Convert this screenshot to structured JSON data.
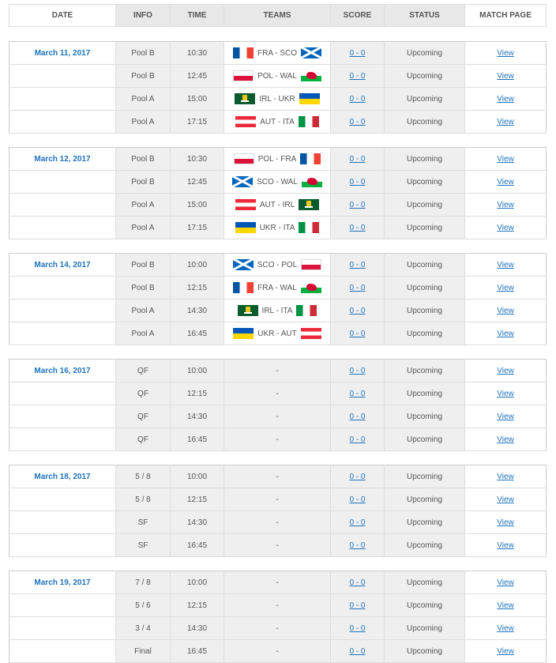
{
  "headers": {
    "date": "DATE",
    "info": "INFO",
    "time": "TIME",
    "teams": "TEAMS",
    "score": "SCORE",
    "status": "STATUS",
    "page": "MATCH PAGE"
  },
  "groups": [
    {
      "date": "March 11, 2017",
      "matches": [
        {
          "info": "Pool B",
          "time": "10:30",
          "home": "fra",
          "away": "sco",
          "teams": "FRA - SCO",
          "score": "0 - 0",
          "status": "Upcoming",
          "link": "View"
        },
        {
          "info": "Pool B",
          "time": "12:45",
          "home": "pol",
          "away": "wal",
          "teams": "POL - WAL",
          "score": "0 - 0",
          "status": "Upcoming",
          "link": "View"
        },
        {
          "info": "Pool A",
          "time": "15:00",
          "home": "irl",
          "away": "ukr",
          "teams": "IRL - UKR",
          "score": "0 - 0",
          "status": "Upcoming",
          "link": "View"
        },
        {
          "info": "Pool A",
          "time": "17:15",
          "home": "aut",
          "away": "ita",
          "teams": "AUT - ITA",
          "score": "0 - 0",
          "status": "Upcoming",
          "link": "View"
        }
      ]
    },
    {
      "date": "March 12, 2017",
      "matches": [
        {
          "info": "Pool B",
          "time": "10:30",
          "home": "pol",
          "away": "fra",
          "teams": "POL - FRA",
          "score": "0 - 0",
          "status": "Upcoming",
          "link": "View"
        },
        {
          "info": "Pool B",
          "time": "12:45",
          "home": "sco",
          "away": "wal",
          "teams": "SCO - WAL",
          "score": "0 - 0",
          "status": "Upcoming",
          "link": "View"
        },
        {
          "info": "Pool A",
          "time": "15:00",
          "home": "aut",
          "away": "irl",
          "teams": "AUT - IRL",
          "score": "0 - 0",
          "status": "Upcoming",
          "link": "View"
        },
        {
          "info": "Pool A",
          "time": "17:15",
          "home": "ukr",
          "away": "ita",
          "teams": "UKR - ITA",
          "score": "0 - 0",
          "status": "Upcoming",
          "link": "View"
        }
      ]
    },
    {
      "date": "March 14, 2017",
      "matches": [
        {
          "info": "Pool B",
          "time": "10:00",
          "home": "sco",
          "away": "pol",
          "teams": "SCO - POL",
          "score": "0 - 0",
          "status": "Upcoming",
          "link": "View"
        },
        {
          "info": "Pool B",
          "time": "12:15",
          "home": "fra",
          "away": "wal",
          "teams": "FRA - WAL",
          "score": "0 - 0",
          "status": "Upcoming",
          "link": "View"
        },
        {
          "info": "Pool A",
          "time": "14:30",
          "home": "irl",
          "away": "ita",
          "teams": "IRL - ITA",
          "score": "0 - 0",
          "status": "Upcoming",
          "link": "View"
        },
        {
          "info": "Pool A",
          "time": "16:45",
          "home": "ukr",
          "away": "aut",
          "teams": "UKR - AUT",
          "score": "0 - 0",
          "status": "Upcoming",
          "link": "View"
        }
      ]
    },
    {
      "date": "March 16, 2017",
      "matches": [
        {
          "info": "QF",
          "time": "10:00",
          "teams": "-",
          "score": "0 - 0",
          "status": "Upcoming",
          "link": "View"
        },
        {
          "info": "QF",
          "time": "12:15",
          "teams": "-",
          "score": "0 - 0",
          "status": "Upcoming",
          "link": "View"
        },
        {
          "info": "QF",
          "time": "14:30",
          "teams": "-",
          "score": "0 - 0",
          "status": "Upcoming",
          "link": "View"
        },
        {
          "info": "QF",
          "time": "16:45",
          "teams": "-",
          "score": "0 - 0",
          "status": "Upcoming",
          "link": "View"
        }
      ]
    },
    {
      "date": "March 18, 2017",
      "matches": [
        {
          "info": "5 / 8",
          "time": "10:00",
          "teams": "-",
          "score": "0 - 0",
          "status": "Upcoming",
          "link": "View"
        },
        {
          "info": "5 / 8",
          "time": "12:15",
          "teams": "-",
          "score": "0 - 0",
          "status": "Upcoming",
          "link": "View"
        },
        {
          "info": "SF",
          "time": "14:30",
          "teams": "-",
          "score": "0 - 0",
          "status": "Upcoming",
          "link": "View"
        },
        {
          "info": "SF",
          "time": "16:45",
          "teams": "-",
          "score": "0 - 0",
          "status": "Upcoming",
          "link": "View"
        }
      ]
    },
    {
      "date": "March 19, 2017",
      "matches": [
        {
          "info": "7 / 8",
          "time": "10:00",
          "teams": "-",
          "score": "0 - 0",
          "status": "Upcoming",
          "link": "View"
        },
        {
          "info": "5 / 6",
          "time": "12:15",
          "teams": "-",
          "score": "0 - 0",
          "status": "Upcoming",
          "link": "View"
        },
        {
          "info": "3 / 4",
          "time": "14:30",
          "teams": "-",
          "score": "0 - 0",
          "status": "Upcoming",
          "link": "View"
        },
        {
          "info": "Final",
          "time": "16:45",
          "teams": "-",
          "score": "0 - 0",
          "status": "Upcoming",
          "link": "View"
        }
      ]
    }
  ]
}
